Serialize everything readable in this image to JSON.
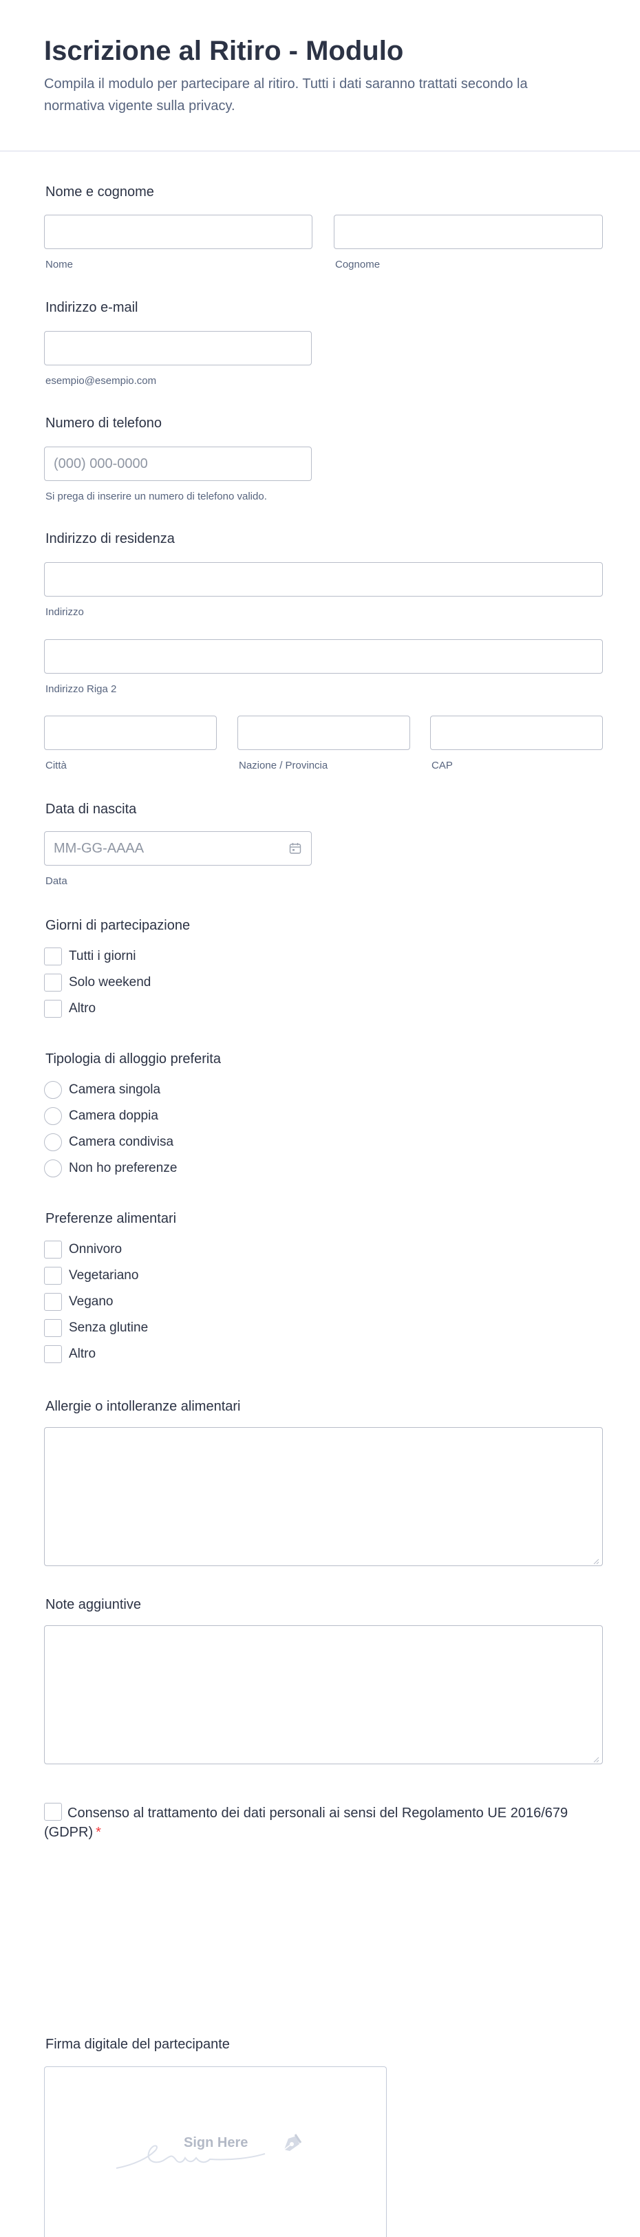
{
  "form": {
    "title": "Iscrizione al Ritiro - Modulo",
    "subtitle": "Compila il modulo per partecipare al ritiro. Tutti i dati saranno trattati secondo la normativa vigente sulla privacy."
  },
  "name": {
    "label": "Nome e cognome",
    "first_sub": "Nome",
    "last_sub": "Cognome"
  },
  "email": {
    "label": "Indirizzo e-mail",
    "sub": "esempio@esempio.com"
  },
  "phone": {
    "label": "Numero di telefono",
    "placeholder": "(000) 000-0000",
    "sub": "Si prega di inserire un numero di telefono valido."
  },
  "address": {
    "label": "Indirizzo di residenza",
    "line1_sub": "Indirizzo",
    "line2_sub": "Indirizzo Riga 2",
    "city_sub": "Città",
    "state_sub": "Nazione / Provincia",
    "zip_sub": "CAP"
  },
  "birth": {
    "label": "Data di nascita",
    "placeholder": "MM-GG-AAAA",
    "sub": "Data",
    "icon": "calendar-icon"
  },
  "days": {
    "label": "Giorni di partecipazione",
    "options": [
      "Tutti i giorni",
      "Solo weekend",
      "Altro"
    ]
  },
  "lodging": {
    "label": "Tipologia di alloggio preferita",
    "options": [
      "Camera singola",
      "Camera doppia",
      "Camera condivisa",
      "Non ho preferenze"
    ]
  },
  "diet": {
    "label": "Preferenze alimentari",
    "options": [
      "Onnivoro",
      "Vegetariano",
      "Vegano",
      "Senza glutine",
      "Altro"
    ]
  },
  "allergies": {
    "label": "Allergie o intolleranze alimentari"
  },
  "notes": {
    "label": "Note aggiuntive"
  },
  "consent": {
    "text": "Consenso al trattamento dei dati personali ai sensi del Regolamento UE 2016/679 (GDPR)",
    "required_mark": "*"
  },
  "signature": {
    "label": "Firma digitale del partecipante",
    "placeholder": "Sign Here",
    "icon": "pen-nib-icon"
  },
  "colors": {
    "required": "#f23a3c",
    "border": "#b8bdc9",
    "text": "#2c3345",
    "muted": "#57647e"
  }
}
